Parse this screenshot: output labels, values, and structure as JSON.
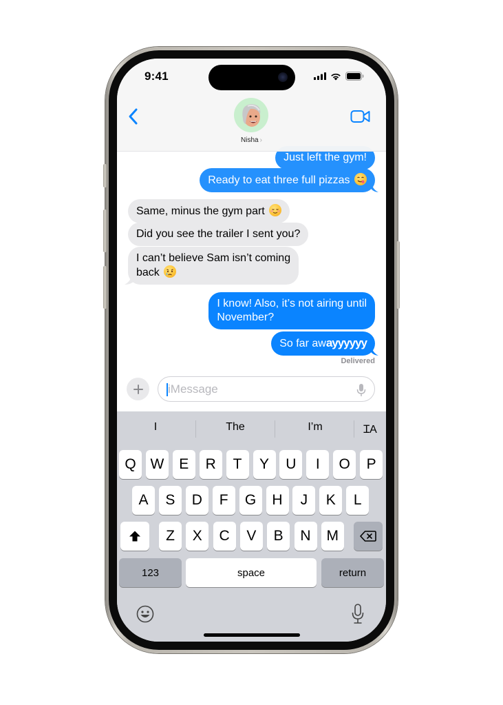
{
  "status_bar": {
    "time": "9:41"
  },
  "header": {
    "contact_name": "Nisha",
    "contact_chevron": "›",
    "back_icon": "chevron-left-icon",
    "video_icon": "video-camera-icon"
  },
  "messages": [
    {
      "direction": "sent",
      "text": "Just left the gym!",
      "emoji": null
    },
    {
      "direction": "sent",
      "text": "Ready to eat three full pizzas",
      "emoji": "face-savoring-food"
    },
    {
      "direction": "received",
      "text": "Same, minus the gym part",
      "emoji": "smiling-face"
    },
    {
      "direction": "received",
      "text": "Did you see the trailer I sent you?",
      "emoji": null
    },
    {
      "direction": "received",
      "text_line1": "I can’t believe Sam isn’t coming",
      "text_line2": "back",
      "emoji": "crying-face"
    },
    {
      "direction": "sent",
      "text_line1": "I know! Also, it’s not airing until",
      "text_line2": "November?",
      "emoji": null
    },
    {
      "direction": "sent",
      "text_prefix": "So far aw",
      "text_emphasis": "ayyyyyy",
      "emoji": null
    }
  ],
  "delivery_status": "Delivered",
  "composer": {
    "placeholder": "iMessage",
    "value": "",
    "plus_icon": "plus-icon",
    "mic_icon": "microphone-icon"
  },
  "keyboard": {
    "suggestions": [
      "I",
      "The",
      "I’m"
    ],
    "format_icon": "text-format-icon",
    "format_label": "ꞮA",
    "row1": [
      "Q",
      "W",
      "E",
      "R",
      "T",
      "Y",
      "U",
      "I",
      "O",
      "P"
    ],
    "row2": [
      "A",
      "S",
      "D",
      "F",
      "G",
      "H",
      "J",
      "K",
      "L"
    ],
    "row3": [
      "Z",
      "X",
      "C",
      "V",
      "B",
      "N",
      "M"
    ],
    "shift_icon": "shift-icon",
    "delete_icon": "backspace-icon",
    "numbers_label": "123",
    "space_label": "space",
    "return_label": "return",
    "emoji_icon": "emoji-icon",
    "dictation_icon": "microphone-icon"
  },
  "colors": {
    "sent_bubble": "#0a84ff",
    "received_bubble": "#e9e9eb",
    "accent": "#0a84ff",
    "keyboard_bg": "#d1d3d9"
  }
}
